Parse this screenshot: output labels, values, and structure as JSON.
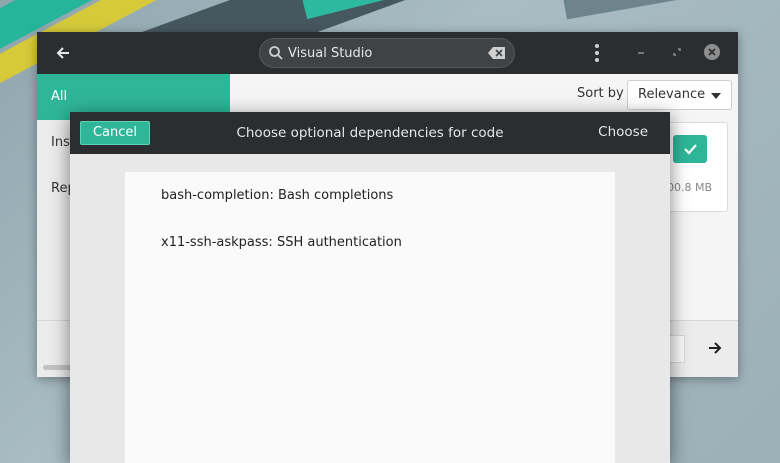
{
  "search": {
    "value": "Visual Studio",
    "placeholder": ""
  },
  "sidebar": {
    "items": [
      {
        "label": "All"
      },
      {
        "label": "Ins"
      },
      {
        "label": "Rep"
      }
    ]
  },
  "sort": {
    "label": "Sort by",
    "selected": "Relevance"
  },
  "card": {
    "size": "00.8 MB"
  },
  "dialog": {
    "cancel_label": "Cancel",
    "title": "Choose optional dependencies for code",
    "choose_label": "Choose",
    "dependencies": [
      "bash-completion: Bash completions",
      "x11-ssh-askpass: SSH authentication"
    ]
  },
  "colors": {
    "accent": "#2fb699",
    "titlebar": "#2b2e30"
  },
  "icons": [
    "back-arrow-icon",
    "search-icon",
    "clear-icon",
    "kebab-menu-icon",
    "minimize-icon",
    "maximize-icon",
    "close-icon",
    "chevron-down-icon",
    "checkmark-icon",
    "next-arrow-icon"
  ]
}
